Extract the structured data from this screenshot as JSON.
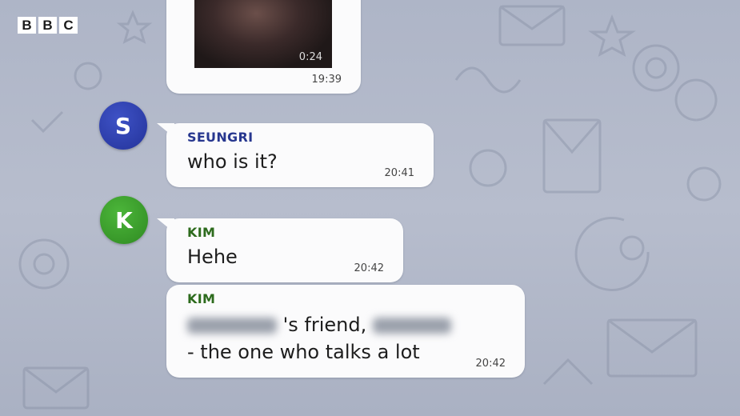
{
  "brand": {
    "letters": [
      "B",
      "B",
      "C"
    ]
  },
  "colors": {
    "seungri_avatar": "#2e3fa8",
    "kim_avatar": "#3a9a2a",
    "seungri_name": "#27378f",
    "kim_name": "#2d6b1d"
  },
  "messages": [
    {
      "type": "video",
      "duration": "0:24",
      "time": "19:39"
    },
    {
      "type": "text",
      "sender": "SEUNGRI",
      "avatar_letter": "S",
      "text": "who is it?",
      "time": "20:41"
    },
    {
      "type": "text",
      "sender": "KIM",
      "avatar_letter": "K",
      "text": "Hehe",
      "time": "20:42"
    },
    {
      "type": "text",
      "sender": "KIM",
      "line1_mid": "'s friend,",
      "line2": "- the one who talks a lot",
      "time": "20:42"
    }
  ]
}
